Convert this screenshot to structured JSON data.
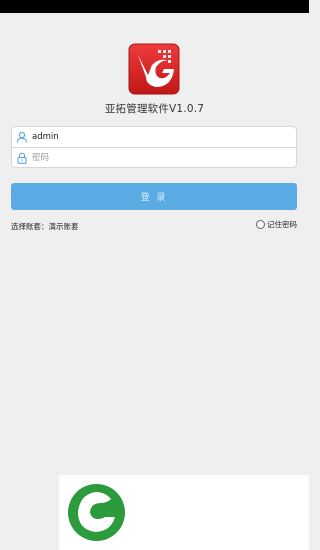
{
  "app": {
    "title": "亚拓管理软件V1.0.7",
    "logo_icon": "app-logo-g-icon"
  },
  "login": {
    "username_value": "admin",
    "password_placeholder": "密码",
    "username_icon": "user-icon",
    "password_icon": "lock-icon",
    "submit_label": "登 录"
  },
  "options": {
    "select_account": "选择账套：演示账套",
    "remember_password": "记住密码"
  },
  "ad": {
    "logo_icon": "green-leaf-g-icon"
  },
  "colors": {
    "accent": "#5aabe3",
    "logo_red": "#d9272e",
    "ad_green": "#2c9b3c"
  }
}
